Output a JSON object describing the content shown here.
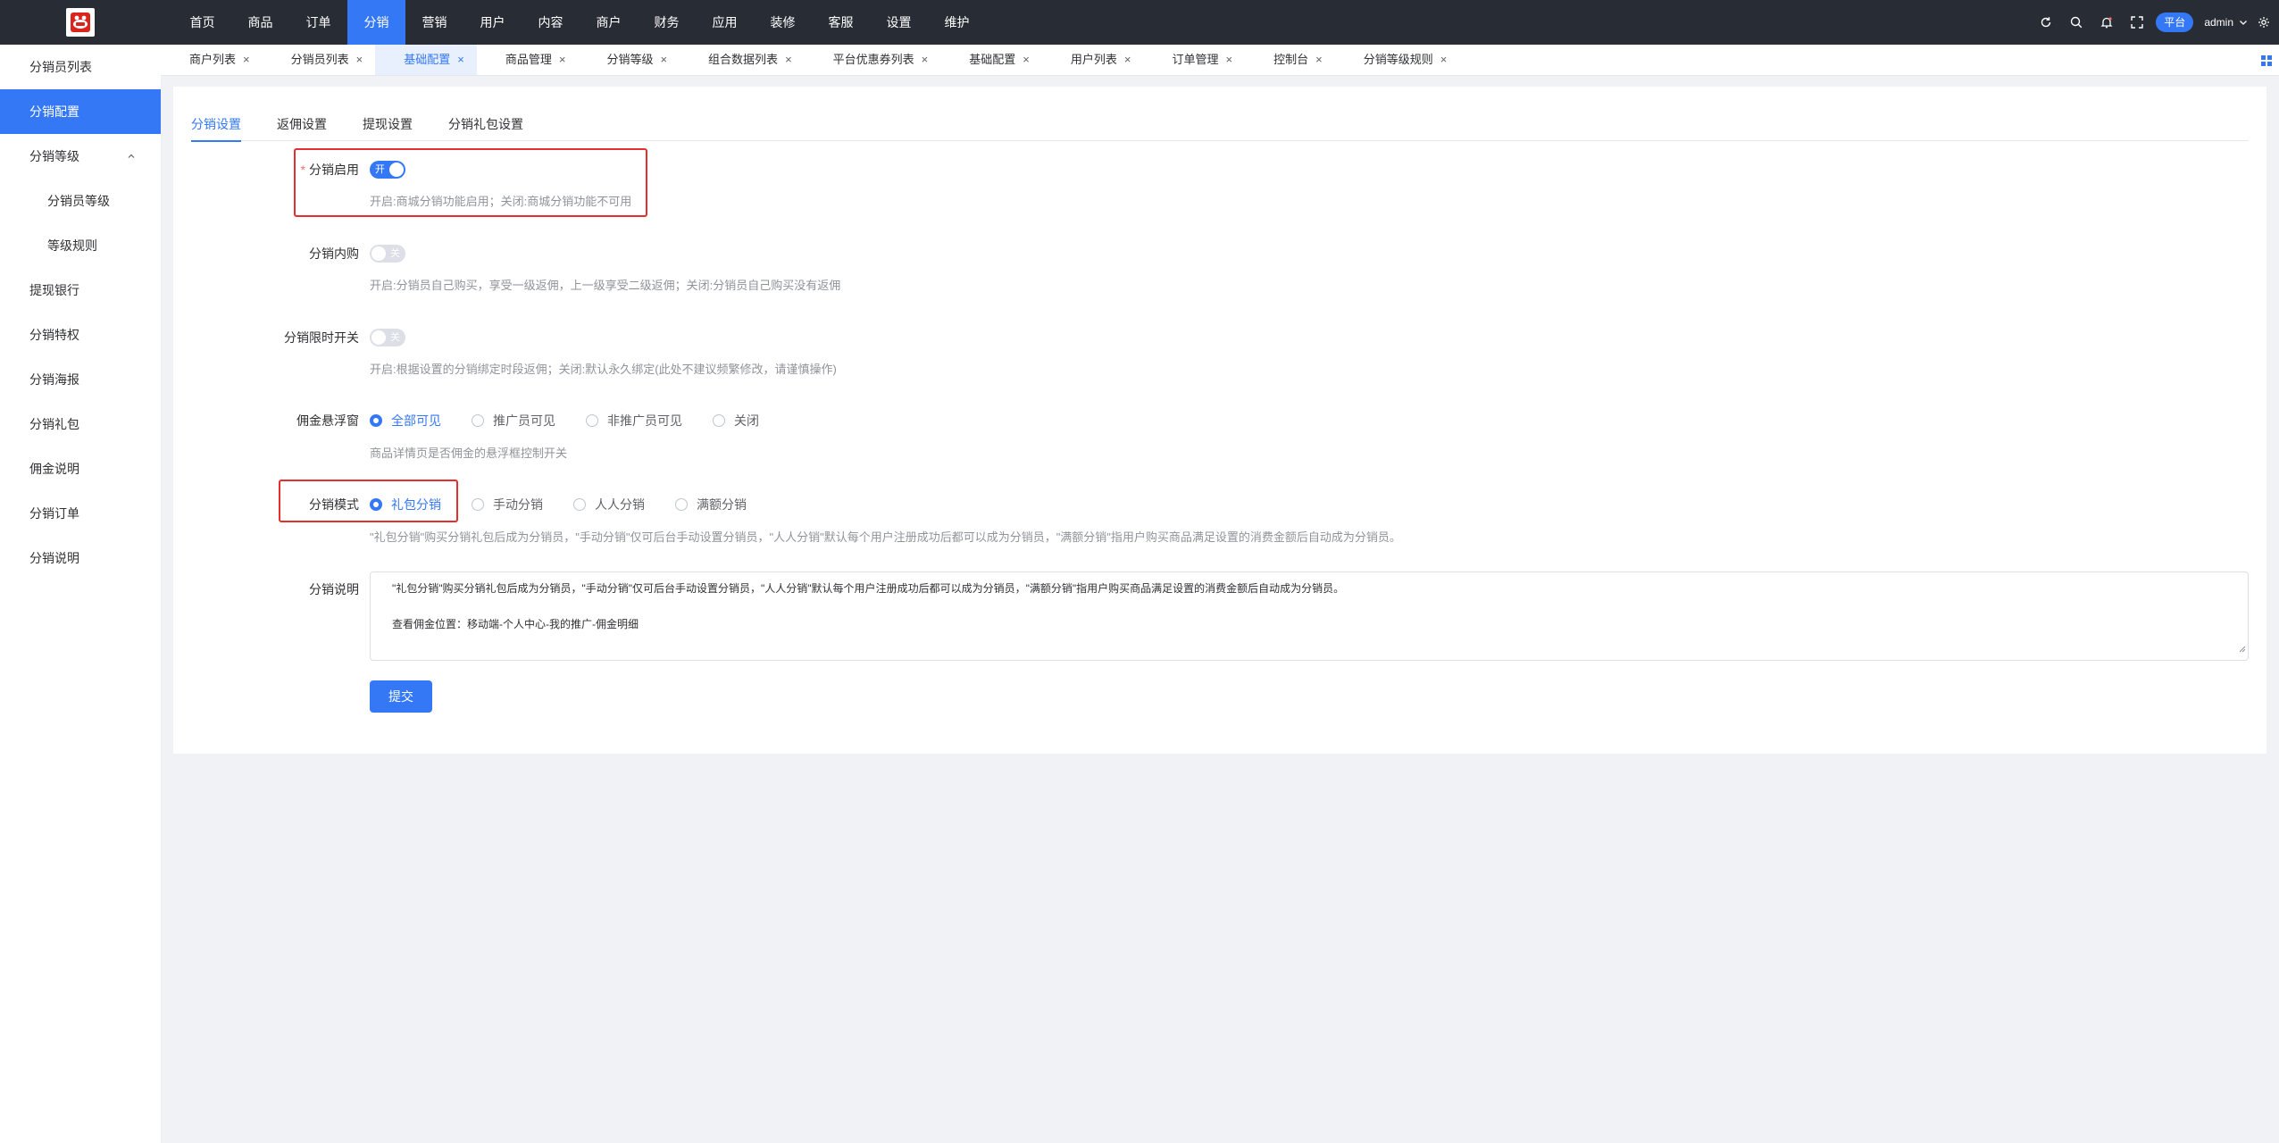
{
  "top_nav": {
    "items": [
      "首页",
      "商品",
      "订单",
      "分销",
      "营销",
      "用户",
      "内容",
      "商户",
      "财务",
      "应用",
      "装修",
      "客服",
      "设置",
      "维护"
    ],
    "active_index": 3
  },
  "top_right": {
    "platform_label": "平台",
    "user_name": "admin"
  },
  "sidebar": {
    "items": [
      {
        "label": "分销员列表"
      },
      {
        "label": "分销配置"
      },
      {
        "label": "分销等级"
      },
      {
        "label": "分销员等级"
      },
      {
        "label": "等级规则"
      },
      {
        "label": "提现银行"
      },
      {
        "label": "分销特权"
      },
      {
        "label": "分销海报"
      },
      {
        "label": "分销礼包"
      },
      {
        "label": "佣金说明"
      },
      {
        "label": "分销订单"
      },
      {
        "label": "分销说明"
      }
    ],
    "active_index": 1
  },
  "tabs": {
    "items": [
      "商户列表",
      "分销员列表",
      "基础配置",
      "商品管理",
      "分销等级",
      "组合数据列表",
      "平台优惠券列表",
      "基础配置",
      "用户列表",
      "订单管理",
      "控制台",
      "分销等级规则"
    ],
    "active_index": 2,
    "close_symbol": "×"
  },
  "subtabs": {
    "items": [
      "分销设置",
      "返佣设置",
      "提现设置",
      "分销礼包设置"
    ],
    "active_index": 0
  },
  "form": {
    "enable": {
      "label": "分销启用",
      "required_mark": "*",
      "switch_text": "开",
      "value": true,
      "hint": "开启:商城分销功能启用；关闭:商城分销功能不可用"
    },
    "self_buy": {
      "label": "分销内购",
      "switch_text": "关",
      "value": false,
      "hint": "开启:分销员自己购买，享受一级返佣，上一级享受二级返佣；关闭:分销员自己购买没有返佣"
    },
    "time_limit": {
      "label": "分销限时开关",
      "switch_text": "关",
      "value": false,
      "hint": "开启:根据设置的分销绑定时段返佣；关闭:默认永久绑定(此处不建议频繁修改，请谨慎操作)"
    },
    "float_window": {
      "label": "佣金悬浮窗",
      "options": [
        "全部可见",
        "推广员可见",
        "非推广员可见",
        "关闭"
      ],
      "selected_index": 0,
      "hint": "商品详情页是否佣金的悬浮框控制开关"
    },
    "mode": {
      "label": "分销模式",
      "options": [
        "礼包分销",
        "手动分销",
        "人人分销",
        "满额分销"
      ],
      "selected_index": 0,
      "hint": "\"礼包分销\"购买分销礼包后成为分销员，\"手动分销\"仅可后台手动设置分销员，\"人人分销\"默认每个用户注册成功后都可以成为分销员，\"满额分销\"指用户购买商品满足设置的消费金额后自动成为分销员。"
    },
    "description": {
      "label": "分销说明",
      "line1": "\"礼包分销\"购买分销礼包后成为分销员，\"手动分销\"仅可后台手动设置分销员，\"人人分销\"默认每个用户注册成功后都可以成为分销员，\"满额分销\"指用户购买商品满足设置的消费金额后自动成为分销员。",
      "line2": "查看佣金位置：移动端-个人中心-我的推广-佣金明细"
    },
    "submit_label": "提交"
  },
  "colors": {
    "primary": "#3478f6",
    "topbar": "#282c34",
    "highlight_box": "#e62e2e"
  }
}
